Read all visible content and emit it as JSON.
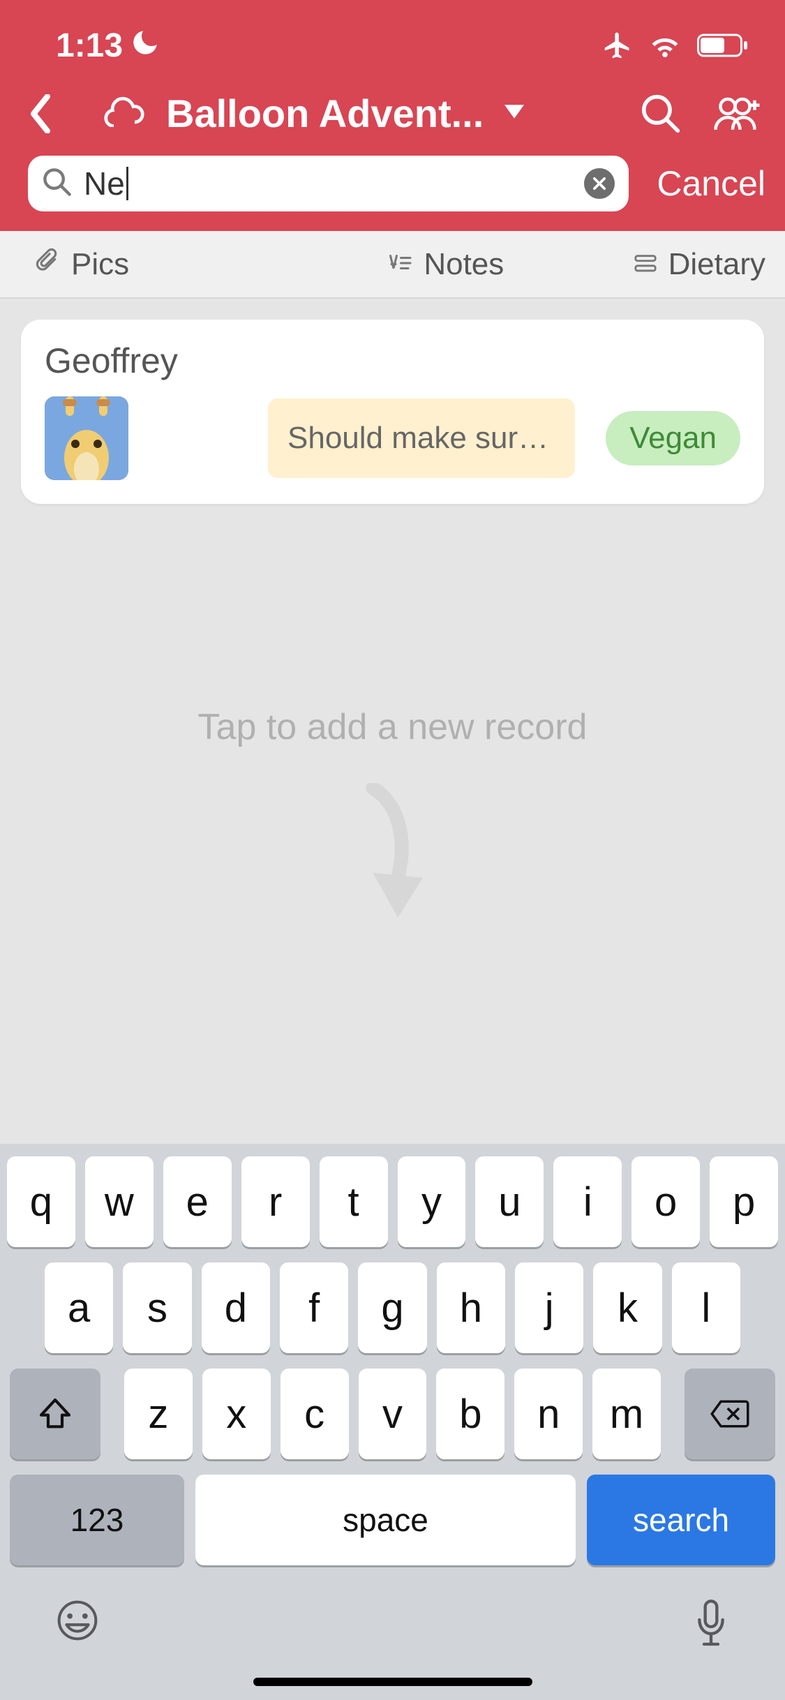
{
  "status": {
    "time": "1:13"
  },
  "nav": {
    "title": "Balloon Advent..."
  },
  "search": {
    "value": "Ne",
    "cancel": "Cancel"
  },
  "columns": {
    "pics": "Pics",
    "notes": "Notes",
    "dietary": "Dietary"
  },
  "record": {
    "name": "Geoffrey",
    "note": "Should make sure t...",
    "dietary": "Vegan"
  },
  "empty": {
    "hint": "Tap to add a new record"
  },
  "keyboard": {
    "row1": [
      "q",
      "w",
      "e",
      "r",
      "t",
      "y",
      "u",
      "i",
      "o",
      "p"
    ],
    "row2": [
      "a",
      "s",
      "d",
      "f",
      "g",
      "h",
      "j",
      "k",
      "l"
    ],
    "row3": [
      "z",
      "x",
      "c",
      "v",
      "b",
      "n",
      "m"
    ],
    "numkey": "123",
    "space": "space",
    "action": "search"
  }
}
